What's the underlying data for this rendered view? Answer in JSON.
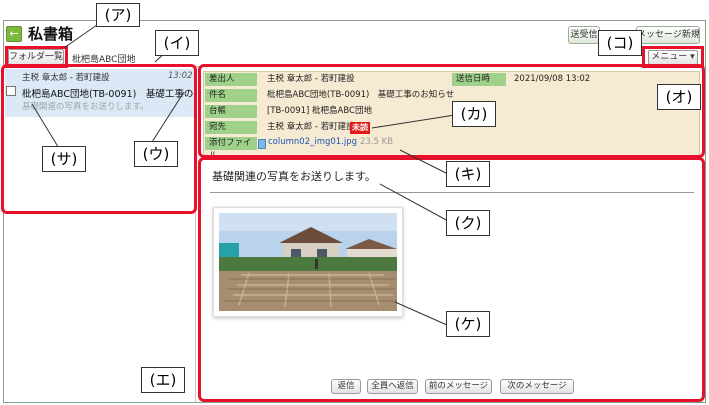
{
  "app": {
    "title": "私書箱",
    "back_glyph": "←"
  },
  "toolbar": {
    "sync_label": "送受信",
    "new_message_label": "メッセージ新規作成",
    "menu_label": "メニュー ▾"
  },
  "folder": {
    "button_label": "フォルダ一覧",
    "current": "枇杷島ABC団地"
  },
  "list": {
    "items": [
      {
        "sender": "主税 章太郎 - 若町建設",
        "time": "13:02",
        "subject": "枇杷島ABC団地(TB-0091)　基礎工事の…",
        "preview": "基礎関連の写真をお送りします。"
      }
    ]
  },
  "message": {
    "labels": {
      "from": "差出人",
      "subject": "件名",
      "ledger": "台帳",
      "to": "宛先",
      "attachment": "添付ファイル",
      "sent_at": "送信日時"
    },
    "from": "主税 章太郎 - 若町建設",
    "subject": "枇杷島ABC団地(TB-0091)　基礎工事のお知らせ",
    "ledger": "[TB-0091] 枇杷島ABC団地",
    "to": "主税 章太郎 - 若町建設",
    "unread": "未読",
    "attachment_name": "column02_img01.jpg",
    "attachment_size": "23.5 KB",
    "sent_at": "2021/09/08 13:02",
    "body": "基礎関連の写真をお送りします。"
  },
  "buttons": {
    "reply": "返信",
    "reply_all": "全員へ返信",
    "prev": "前のメッセージ",
    "next": "次のメッセージ"
  },
  "annotations": {
    "a": "(ア)",
    "i": "(イ)",
    "u": "(ウ)",
    "e": "(エ)",
    "o": "(オ)",
    "ka": "(カ)",
    "ki": "(キ)",
    "ku": "(ク)",
    "ke": "(ケ)",
    "ko": "(コ)",
    "sa": "(サ)"
  },
  "colors": {
    "accent_green": "#9fd18a",
    "header_bg": "#f6ead2",
    "selected_row": "#dbe8f6",
    "annotation_red": "#e8102a",
    "unread_badge": "#e21a1a",
    "link_blue": "#1c55b6"
  }
}
